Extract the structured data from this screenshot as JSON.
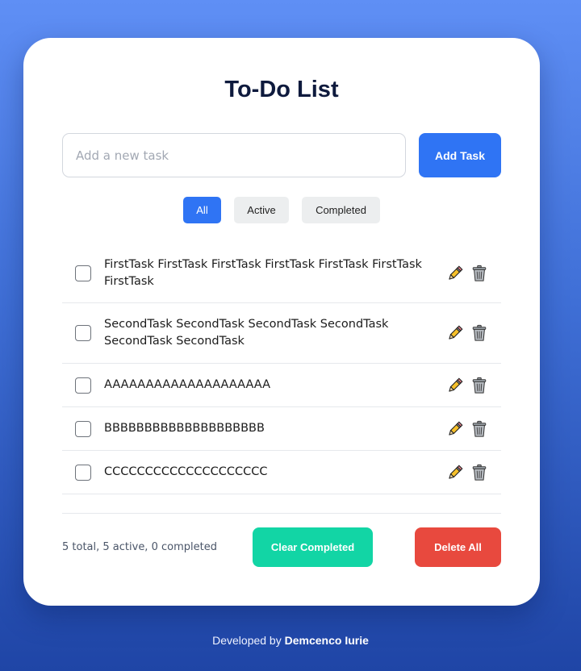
{
  "app": {
    "title": "To-Do List"
  },
  "input": {
    "placeholder": "Add a new task",
    "value": "",
    "add_label": "Add Task"
  },
  "filters": [
    {
      "label": "All",
      "active": true
    },
    {
      "label": "Active",
      "active": false
    },
    {
      "label": "Completed",
      "active": false
    }
  ],
  "tasks": [
    {
      "text": "FirstTask FirstTask FirstTask FirstTask FirstTask FirstTask FirstTask",
      "completed": false
    },
    {
      "text": "SecondTask SecondTask SecondTask SecondTask SecondTask SecondTask",
      "completed": false
    },
    {
      "text": "AAAAAAAAAAAAAAAAAAAA",
      "completed": false
    },
    {
      "text": "BBBBBBBBBBBBBBBBBBBB",
      "completed": false
    },
    {
      "text": "CCCCCCCCCCCCCCCCCCCC",
      "completed": false
    }
  ],
  "icons": {
    "edit": "pencil-icon",
    "delete": "trash-icon"
  },
  "footer": {
    "stats": "5 total, 5 active, 0 completed",
    "clear_label": "Clear Completed",
    "delete_all_label": "Delete All"
  },
  "credits": {
    "prefix": "Developed by",
    "author": "Demcenco Iurie"
  },
  "colors": {
    "primary": "#2f74f4",
    "clear": "#12d5a5",
    "danger": "#e8493e"
  }
}
